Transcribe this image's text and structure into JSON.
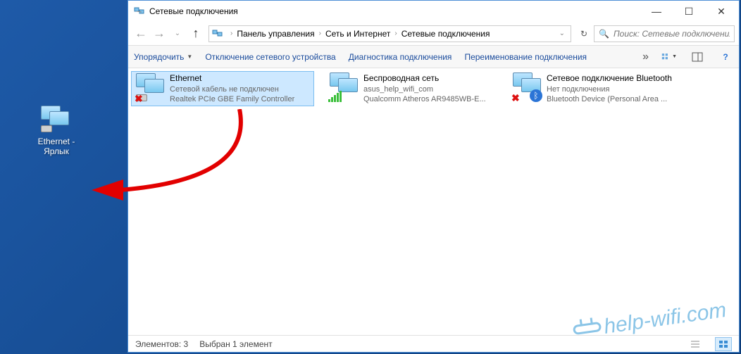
{
  "desktop": {
    "shortcut_label": "Ethernet - Ярлык"
  },
  "window": {
    "title": "Сетевые подключения",
    "controls": {
      "min": "—",
      "max": "☐",
      "close": "✕"
    }
  },
  "nav": {
    "breadcrumbs": [
      "Панель управления",
      "Сеть и Интернет",
      "Сетевые подключения"
    ],
    "search_placeholder": "Поиск: Сетевые подключения"
  },
  "commands": {
    "organize": "Упорядочить",
    "disable": "Отключение сетевого устройства",
    "diagnose": "Диагностика подключения",
    "rename": "Переименование подключения"
  },
  "items": [
    {
      "name": "Ethernet",
      "status": "Сетевой кабель не подключен",
      "device": "Realtek PCIe GBE Family Controller",
      "overlay": "cross",
      "selected": true
    },
    {
      "name": "Беспроводная сеть",
      "status": "asus_help_wifi_com",
      "device": "Qualcomm Atheros AR9485WB-E...",
      "overlay": "bars",
      "selected": false
    },
    {
      "name": "Сетевое подключение Bluetooth",
      "status": "Нет подключения",
      "device": "Bluetooth Device (Personal Area ...",
      "overlay": "bt-cross",
      "selected": false
    }
  ],
  "statusbar": {
    "count_label": "Элементов: 3",
    "selection_label": "Выбран 1 элемент"
  },
  "watermark": "help-wifi.com"
}
